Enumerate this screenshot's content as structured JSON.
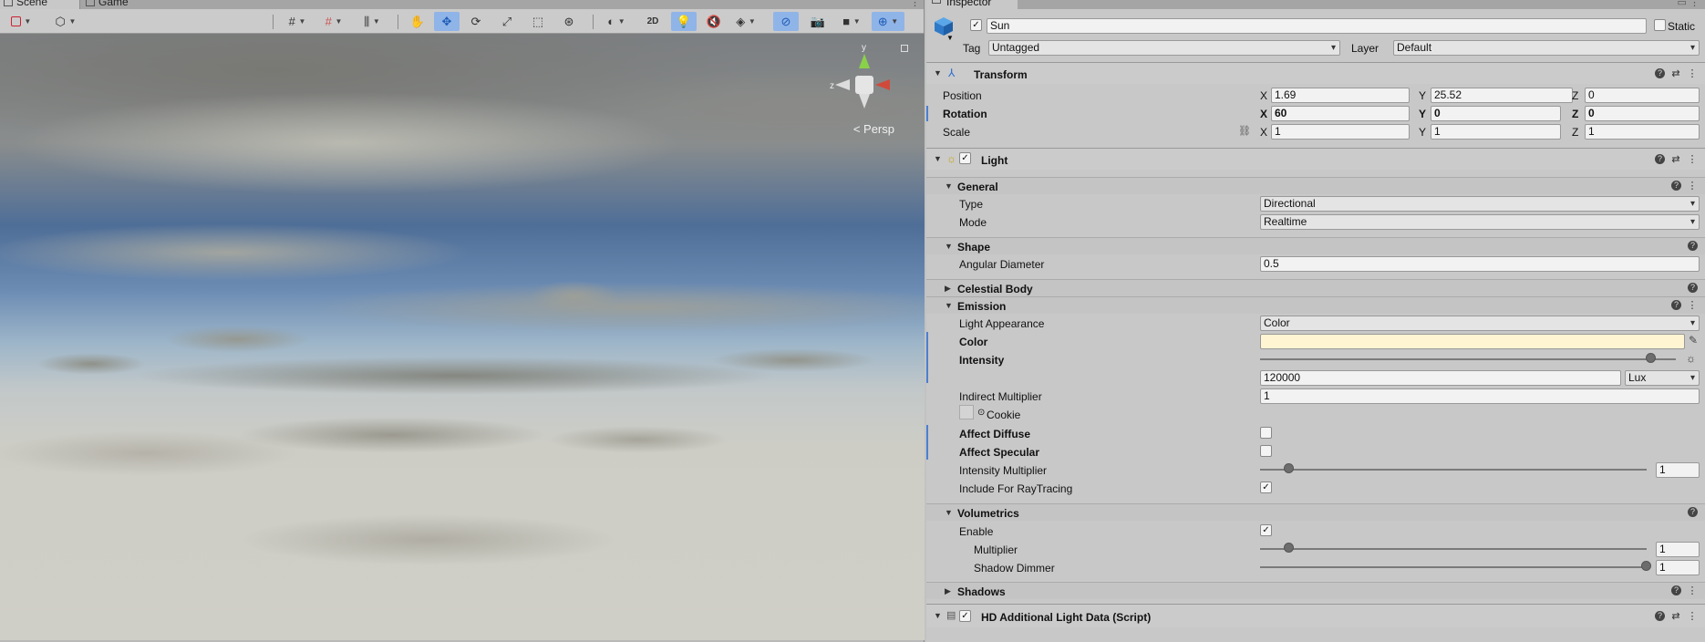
{
  "scene_tabs": {
    "scene": "Scene",
    "game": "Game"
  },
  "scene_toolbar": {
    "mode_2d": "2D"
  },
  "scene_view": {
    "gizmo_y": "y",
    "gizmo_z": "z",
    "persp_label": "Persp"
  },
  "inspector": {
    "tab_title": "Inspector",
    "object": {
      "name": "Sun",
      "active": true,
      "static_label": "Static",
      "static": false,
      "tag_label": "Tag",
      "tag_value": "Untagged",
      "layer_label": "Layer",
      "layer_value": "Default"
    },
    "transform": {
      "title": "Transform",
      "position_label": "Position",
      "rotation_label": "Rotation",
      "scale_label": "Scale",
      "x": "X",
      "y": "Y",
      "z": "Z",
      "position": {
        "x": "1.69",
        "y": "25.52",
        "z": "0"
      },
      "rotation": {
        "x": "60",
        "y": "0",
        "z": "0"
      },
      "scale": {
        "x": "1",
        "y": "1",
        "z": "1"
      }
    },
    "light": {
      "title": "Light",
      "enabled": true,
      "general": {
        "title": "General",
        "type_label": "Type",
        "type_value": "Directional",
        "mode_label": "Mode",
        "mode_value": "Realtime"
      },
      "shape": {
        "title": "Shape",
        "angular_diameter_label": "Angular Diameter",
        "angular_diameter_value": "0.5"
      },
      "celestial_body": {
        "title": "Celestial Body"
      },
      "emission": {
        "title": "Emission",
        "light_appearance_label": "Light Appearance",
        "light_appearance_value": "Color",
        "color_label": "Color",
        "color_value": "#fff5d3",
        "intensity_label": "Intensity",
        "intensity_value": "120000",
        "intensity_unit": "Lux",
        "intensity_slider_fraction": 0.94,
        "indirect_multiplier_label": "Indirect Multiplier",
        "indirect_multiplier_value": "1",
        "cookie_label": "Cookie",
        "affect_diffuse_label": "Affect Diffuse",
        "affect_diffuse": false,
        "affect_specular_label": "Affect Specular",
        "affect_specular": false,
        "intensity_multiplier_label": "Intensity Multiplier",
        "intensity_multiplier_value": "1",
        "include_raytracing_label": "Include For RayTracing",
        "include_raytracing": true
      },
      "volumetrics": {
        "title": "Volumetrics",
        "enable_label": "Enable",
        "enable": true,
        "multiplier_label": "Multiplier",
        "multiplier_value": "1",
        "shadow_dimmer_label": "Shadow Dimmer",
        "shadow_dimmer_value": "1"
      },
      "shadows": {
        "title": "Shadows"
      }
    },
    "hd_data": {
      "title": "HD Additional Light Data (Script)",
      "enabled": true
    }
  }
}
